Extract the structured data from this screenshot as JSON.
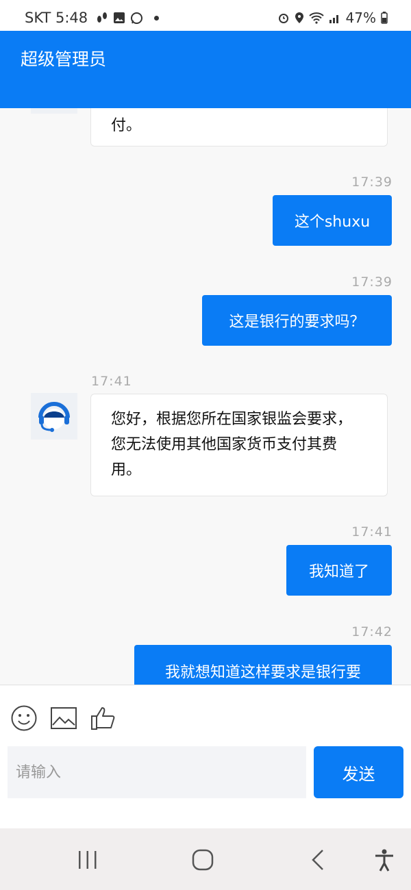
{
  "status_bar": {
    "carrier_time": "SKT 5:48",
    "battery": "47%"
  },
  "header": {
    "title": "超级管理员"
  },
  "messages": [
    {
      "side": "in",
      "text": "付。"
    },
    {
      "time": "17:39",
      "side": "out",
      "text": "这个shuxu"
    },
    {
      "time": "17:39",
      "side": "out",
      "text": "这是银行的要求吗？"
    },
    {
      "time": "17:41",
      "side": "in",
      "text": "您好，根据您所在国家银监会要求，您无法使用其他国家货币支付其费用。"
    },
    {
      "time": "17:41",
      "side": "out",
      "text": "我知道了"
    },
    {
      "time": "17:42",
      "side": "out",
      "text": "我就想知道这样要求是银行要"
    }
  ],
  "composer": {
    "placeholder": "请输入",
    "send_label": "发送"
  },
  "icons": {
    "toolbar": [
      "emoji-icon",
      "image-icon",
      "thumbs-up-icon"
    ],
    "nav": [
      "recent-apps-icon",
      "home-icon",
      "back-icon",
      "accessibility-icon"
    ]
  },
  "colors": {
    "accent": "#0a7cf5"
  }
}
